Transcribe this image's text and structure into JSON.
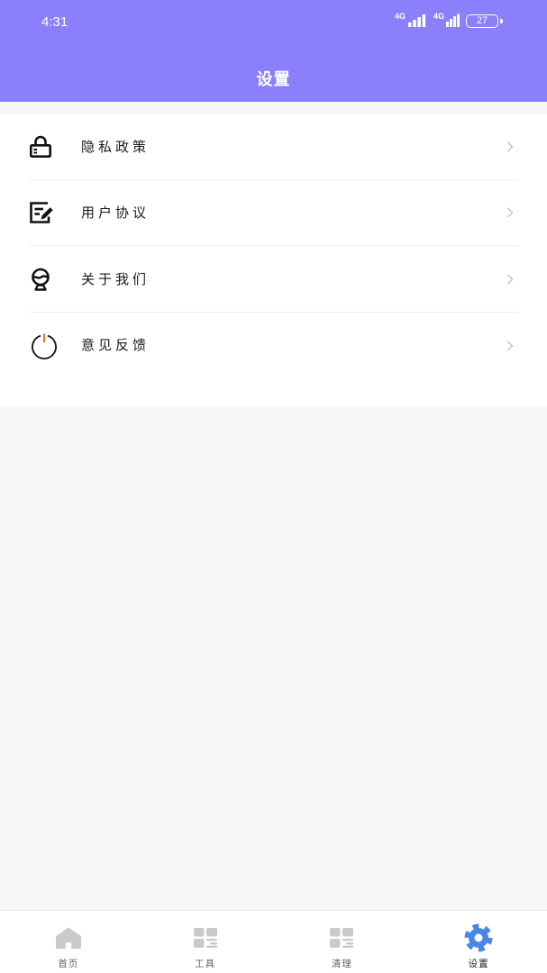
{
  "status_bar": {
    "time": "4:31",
    "sim1_network": "4G",
    "sim2_network": "4G",
    "battery_level": "27"
  },
  "header": {
    "title": "设置"
  },
  "settings": {
    "items": [
      {
        "label": "隐私政策",
        "icon": "lock-icon"
      },
      {
        "label": "用户协议",
        "icon": "agreement-edit-icon"
      },
      {
        "label": "关于我们",
        "icon": "about-us-icon"
      },
      {
        "label": "意见反馈",
        "icon": "power-feedback-icon"
      }
    ],
    "chevron_icon": "chevron-right-icon"
  },
  "bottom_nav": {
    "tabs": [
      {
        "label": "首页",
        "icon": "home-icon",
        "active": false
      },
      {
        "label": "工具",
        "icon": "tools-grid-icon",
        "active": false
      },
      {
        "label": "清理",
        "icon": "clean-grid-icon",
        "active": false
      },
      {
        "label": "设置",
        "icon": "settings-gear-icon",
        "active": true
      }
    ]
  },
  "colors": {
    "header_bg": "#8b7ffb",
    "page_bg": "#f7f7f7",
    "active_tab": "#4a86e8",
    "inactive_tab_icon": "#cacaca",
    "power_accent": "#f06a2a"
  }
}
